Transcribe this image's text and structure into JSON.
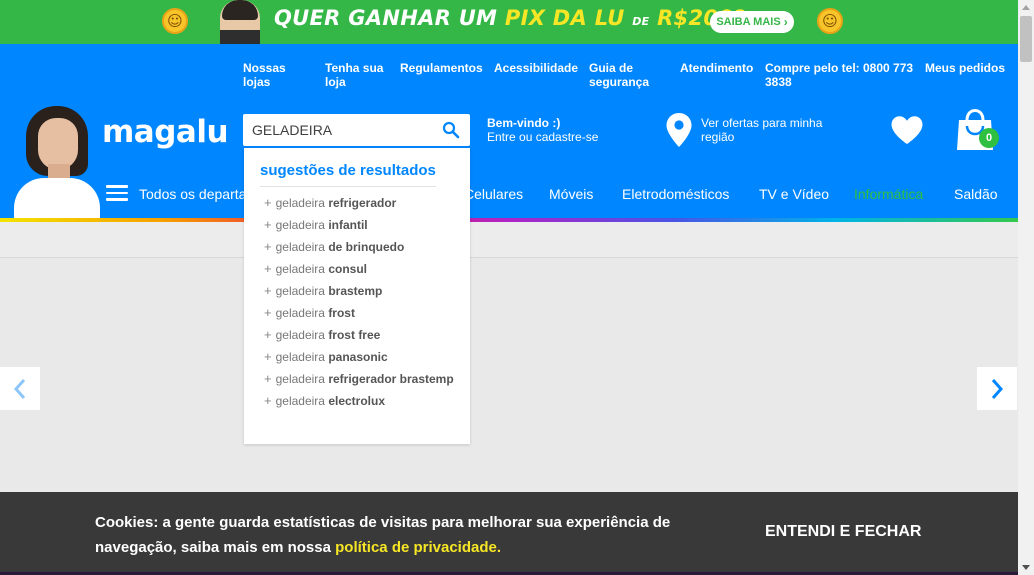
{
  "promo": {
    "headline_white": "QUER GANHAR UM",
    "headline_yellow": "PIX DA LU",
    "headline_small": "DE",
    "headline_amount": "R$200?",
    "headline_mark": "*",
    "cta_label": "SAIBA MAIS",
    "emoji_icon": "laughing-emoji-icon",
    "background_color": "#35b748"
  },
  "top_links": [
    "Nossas lojas",
    "Tenha sua loja",
    "Regulamentos",
    "Acessibilidade",
    "Guia de segurança",
    "Atendimento",
    "Compre pelo tel: 0800 773 3838",
    "Meus pedidos"
  ],
  "logo": "magalu",
  "search": {
    "value": "GELADEIRA",
    "icon": "search-icon"
  },
  "account": {
    "greeting": "Bem-vindo :)",
    "action": "Entre ou cadastre-se"
  },
  "region": {
    "label": "Ver ofertas para minha região",
    "icon": "location-pin-icon"
  },
  "cart": {
    "count": "0",
    "icon": "shopping-bag-icon"
  },
  "favorites_icon": "heart-icon",
  "nav": {
    "departments": "Todos os departamentos",
    "items": [
      "Celulares",
      "Móveis",
      "Eletrodomésticos",
      "TV e Vídeo",
      "Informática",
      "Saldão"
    ],
    "active": "Informática"
  },
  "suggestions": {
    "title": "sugestões de resultados",
    "prefix": "geladeira",
    "items": [
      "refrigerador",
      "infantil",
      "de brinquedo",
      "consul",
      "brastemp",
      "frost",
      "frost free",
      "panasonic",
      "refrigerador brastemp",
      "electrolux"
    ]
  },
  "cookie": {
    "message": "Cookies: a gente guarda estatísticas de visitas para melhorar sua experiência de navegação, saiba mais em nossa",
    "link": "política de privacidade.",
    "accept_label": "ENTENDI E FECHAR"
  },
  "colors": {
    "brand_blue": "#0086ff",
    "accent_green": "#2fbf41",
    "link_yellow": "#f6e625"
  }
}
